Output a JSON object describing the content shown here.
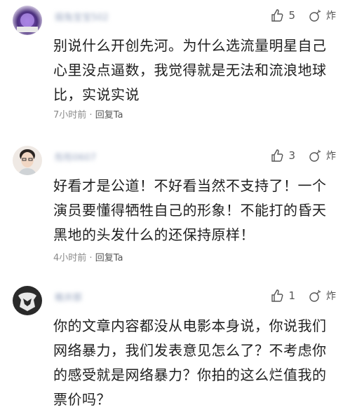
{
  "comments": [
    {
      "username": "摇兔宝宝502",
      "likes": "5",
      "bomb_label": "炸",
      "text": "别说什么开创先河。为什么选流量明星自己心里没点逼数，我觉得就是无法和流浪地球比，实说实说",
      "time": "7小时前",
      "separator": "·",
      "reply": "回复Ta"
    },
    {
      "username": "彤彤0607",
      "likes": "3",
      "bomb_label": "炸",
      "text": "好看才是公道！不好看当然不支持了！一个演员要懂得牺牲自己的形象！不能打的昏天黑地的头发什么的还保持原样！",
      "time": "4小时前",
      "separator": "·",
      "reply": "回复Ta"
    },
    {
      "username": "稚井那",
      "likes": "1",
      "bomb_label": "炸",
      "text": "你的文章内容都没从电影本身说，你说我们网络暴力，我们发表意见怎么了？不考虑你的感受就是网络暴力？你拍的这么烂值我的票价吗？",
      "time": "",
      "separator": "",
      "reply": ""
    }
  ],
  "colors": {
    "meta": "#8a8a8a",
    "username": "#9aa7c0",
    "text": "#1e1e1e"
  }
}
